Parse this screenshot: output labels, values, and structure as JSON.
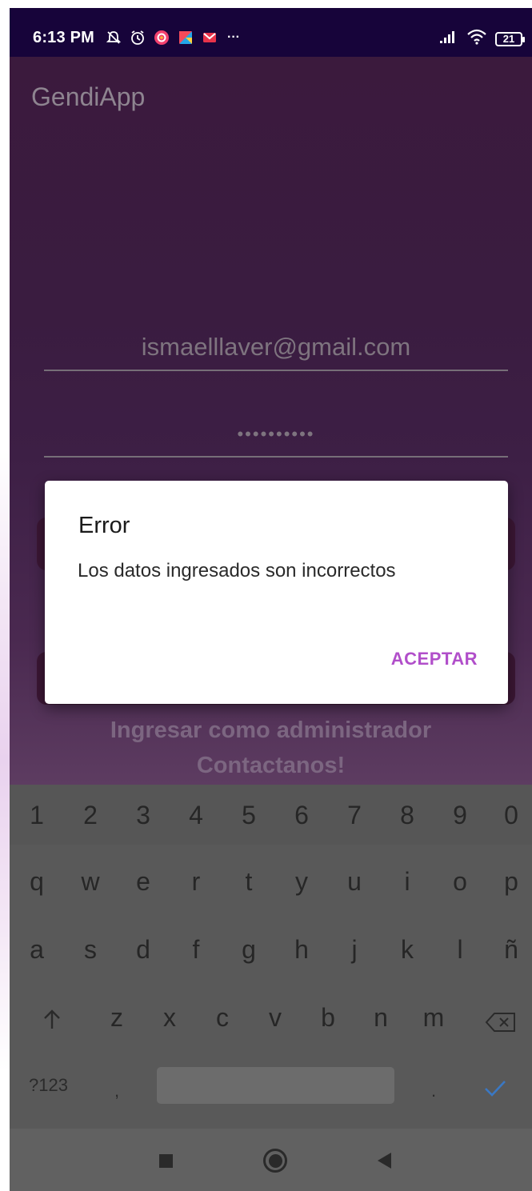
{
  "status_bar": {
    "time": "6:13 PM",
    "battery": "21",
    "icons": [
      "silent-icon",
      "alarm-icon",
      "instagram-icon",
      "app-icon",
      "gmail-icon",
      "more-icon"
    ],
    "right_icons": [
      "signal-icon",
      "wifi-icon",
      "battery-icon"
    ],
    "more": "···"
  },
  "app": {
    "title": "GendiApp",
    "email_value": "ismaelllaver@gmail.com",
    "password_value": "••••••••••",
    "link_admin": "Ingresar como administrador",
    "link_contact": "Contactanos!"
  },
  "dialog": {
    "title": "Error",
    "message": "Los datos ingresados son incorrectos",
    "button": "ACEPTAR",
    "accent": "#b14fca"
  },
  "keyboard": {
    "numbers": [
      "1",
      "2",
      "3",
      "4",
      "5",
      "6",
      "7",
      "8",
      "9",
      "0"
    ],
    "row1": [
      "q",
      "w",
      "e",
      "r",
      "t",
      "y",
      "u",
      "i",
      "o",
      "p"
    ],
    "row2": [
      "a",
      "s",
      "d",
      "f",
      "g",
      "h",
      "j",
      "k",
      "l",
      "ñ"
    ],
    "row3": [
      "z",
      "x",
      "c",
      "v",
      "b",
      "n",
      "m"
    ],
    "symbols_label": "?123",
    "comma": ",",
    "period": "."
  },
  "colors": {
    "status_bar_bg": "#17043a",
    "keyboard_bg": "#595959",
    "check_color": "#3a78c4"
  }
}
